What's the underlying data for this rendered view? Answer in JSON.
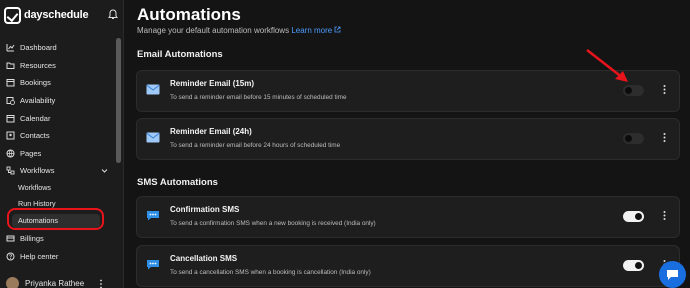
{
  "brand": {
    "name": "dayschedule"
  },
  "sidebar": {
    "items": [
      {
        "label": "Dashboard",
        "icon": "dashboard-icon"
      },
      {
        "label": "Resources",
        "icon": "folder-icon"
      },
      {
        "label": "Bookings",
        "icon": "calendar-check-icon"
      },
      {
        "label": "Availability",
        "icon": "calendar-clock-icon"
      },
      {
        "label": "Calendar",
        "icon": "calendar-icon"
      },
      {
        "label": "Contacts",
        "icon": "contacts-icon"
      },
      {
        "label": "Pages",
        "icon": "globe-icon"
      },
      {
        "label": "Workflows",
        "icon": "workflow-icon"
      }
    ],
    "workflow_sub": [
      "Workflows",
      "Run History",
      "Automations"
    ],
    "bottom_items": [
      {
        "label": "Billings",
        "icon": "billing-icon"
      },
      {
        "label": "Help center",
        "icon": "help-icon"
      }
    ],
    "user": {
      "name": "Priyanka Rathee"
    }
  },
  "main": {
    "title": "Automations",
    "subtitle": "Manage your default automation workflows",
    "learn_more": "Learn more",
    "email_section": "Email Automations",
    "sms_section": "SMS Automations",
    "email_cards": [
      {
        "title": "Reminder Email (15m)",
        "desc": "To send a reminder email before 15 minutes of scheduled time",
        "enabled": false
      },
      {
        "title": "Reminder Email (24h)",
        "desc": "To send a reminder email before 24 hours of scheduled time",
        "enabled": false
      }
    ],
    "sms_cards": [
      {
        "title": "Confirmation SMS",
        "desc": "To send a confirmation SMS when a new booking is received (India only)",
        "enabled": true
      },
      {
        "title": "Cancellation SMS",
        "desc": "To send a cancellation SMS when a booking is cancellation (India only)",
        "enabled": true
      }
    ]
  },
  "colors": {
    "accent": "#4e9cff",
    "highlight": "#e8141c",
    "chat": "#1a6fe0"
  }
}
